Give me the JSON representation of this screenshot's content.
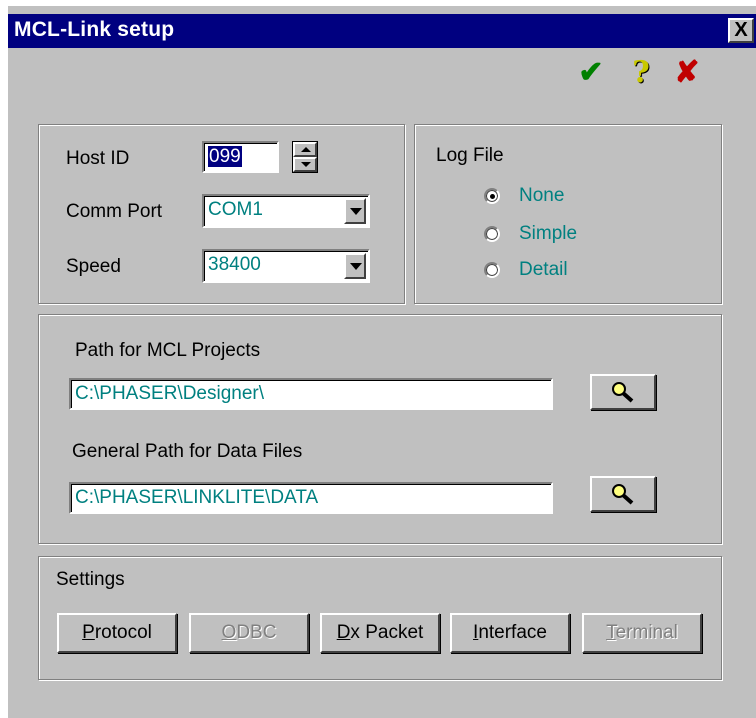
{
  "window": {
    "title": "MCL-Link setup",
    "close_glyph": "X"
  },
  "toolbar": {
    "ok_icon": "checkmark-icon",
    "ok_glyph": "✔",
    "ok_color": "#008000",
    "help_icon": "question-icon",
    "help_glyph": "?",
    "help_color": "#c8c800",
    "cancel_icon": "x-icon",
    "cancel_glyph": "✘",
    "cancel_color": "#c00000"
  },
  "connection": {
    "host_id_label": "Host ID",
    "host_id_value": "099",
    "comm_port_label": "Comm Port",
    "comm_port_value": "COM1",
    "speed_label": "Speed",
    "speed_value": "38400"
  },
  "log_file": {
    "title": "Log File",
    "options": [
      {
        "label": "None",
        "selected": true
      },
      {
        "label": "Simple",
        "selected": false
      },
      {
        "label": "Detail",
        "selected": false
      }
    ]
  },
  "paths": {
    "projects_label": "Path for MCL Projects",
    "projects_value": "C:\\PHASER\\Designer\\",
    "data_label": "General Path for Data Files",
    "data_value": "C:\\PHASER\\LINKLITE\\DATA",
    "browse_icon": "magnifier-icon"
  },
  "settings": {
    "title": "Settings",
    "buttons": [
      {
        "pre": "",
        "key": "P",
        "post": "rotocol",
        "enabled": true
      },
      {
        "pre": "",
        "key": "O",
        "post": "DBC",
        "enabled": false
      },
      {
        "pre": "",
        "key": "D",
        "post": "x Packet",
        "enabled": true
      },
      {
        "pre": "",
        "key": "I",
        "post": "nterface",
        "enabled": true
      },
      {
        "pre": "",
        "key": "T",
        "post": "erminal",
        "enabled": false
      }
    ]
  }
}
